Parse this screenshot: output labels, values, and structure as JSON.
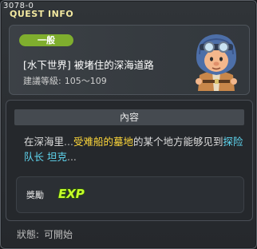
{
  "quest_id": "3078-0",
  "window_title": "QUEST INFO",
  "quest": {
    "category": "一般",
    "name": "[水下世界] 被堵住的深海道路",
    "level_label": "建議等級:",
    "level_range": "105～109"
  },
  "content": {
    "header": "內容",
    "desc_part1": "在深海里",
    "desc_dots1": "...",
    "desc_highlight1": "受难船的墓地",
    "desc_part2": "的某个地方能够见到",
    "desc_highlight2": "探险队长 坦克",
    "desc_dots2": "..."
  },
  "reward": {
    "label": "獎勵",
    "icon": "exp-icon"
  },
  "status": {
    "label": "狀態:",
    "value": "可開始"
  },
  "colors": {
    "badge": "#7fae2e",
    "highlight_yellow": "#ffd83a",
    "highlight_cyan": "#5fd6f0"
  }
}
